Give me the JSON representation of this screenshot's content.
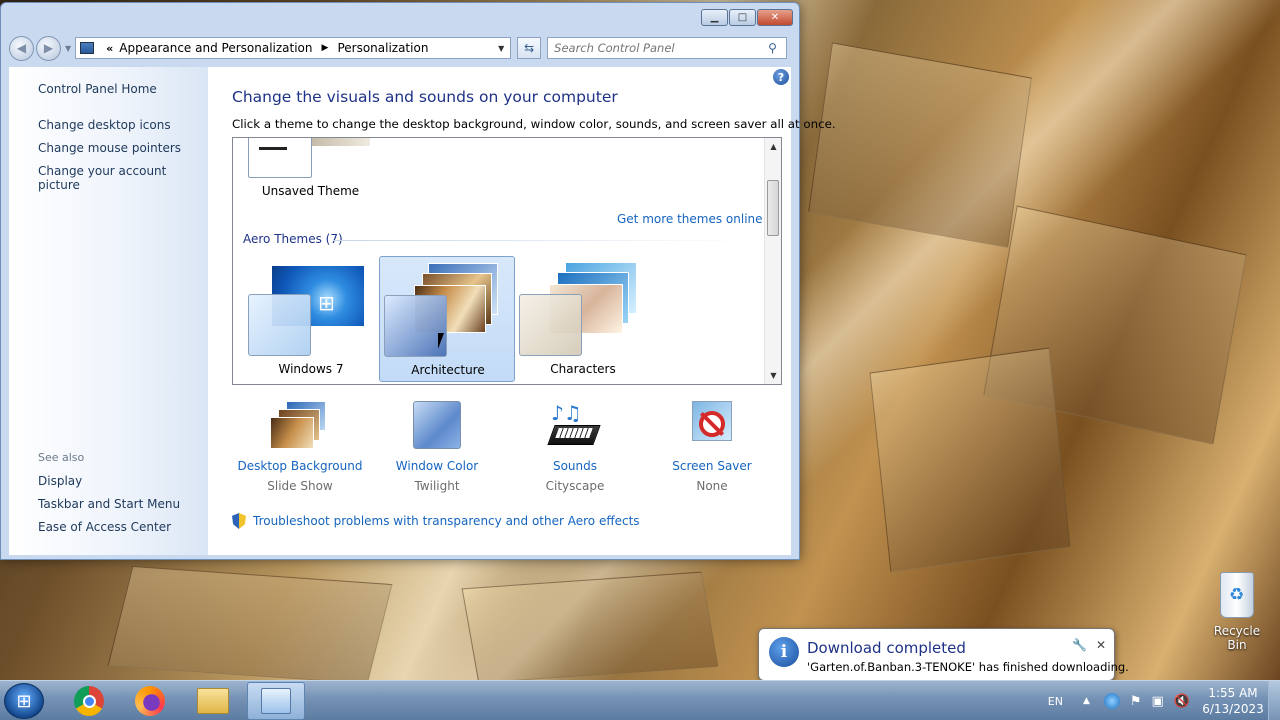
{
  "window": {
    "breadcrumb": [
      "Appearance and Personalization",
      "Personalization"
    ],
    "search_placeholder": "Search Control Panel"
  },
  "sidebar": {
    "home": "Control Panel Home",
    "links": [
      "Change desktop icons",
      "Change mouse pointers",
      "Change your account picture"
    ],
    "see_also_label": "See also",
    "see_also": [
      "Display",
      "Taskbar and Start Menu",
      "Ease of Access Center"
    ]
  },
  "main": {
    "heading": "Change the visuals and sounds on your computer",
    "subtext": "Click a theme to change the desktop background, window color, sounds, and screen saver all at once.",
    "unsaved_theme": "Unsaved Theme",
    "more_themes": "Get more themes online",
    "aero_group": "Aero Themes (7)",
    "themes": [
      "Windows 7",
      "Architecture",
      "Characters"
    ],
    "selected_theme": "Architecture",
    "settings": [
      {
        "label": "Desktop Background",
        "value": "Slide Show",
        "icon": "desktop-background-icon"
      },
      {
        "label": "Window Color",
        "value": "Twilight",
        "icon": "window-color-icon"
      },
      {
        "label": "Sounds",
        "value": "Cityscape",
        "icon": "sounds-icon"
      },
      {
        "label": "Screen Saver",
        "value": "None",
        "icon": "screen-saver-icon"
      }
    ],
    "troubleshoot": "Troubleshoot problems with transparency and other Aero effects"
  },
  "desktop": {
    "recycle_bin": "Recycle Bin"
  },
  "notification": {
    "title": "Download completed",
    "message": "'Garten.of.Banban.3-TENOKE' has finished downloading."
  },
  "taskbar": {
    "apps": [
      "chrome-icon",
      "firefox-icon",
      "file-explorer-icon",
      "control-panel-icon"
    ],
    "language": "EN",
    "time": "1:55 AM",
    "date": "6/13/2023"
  }
}
